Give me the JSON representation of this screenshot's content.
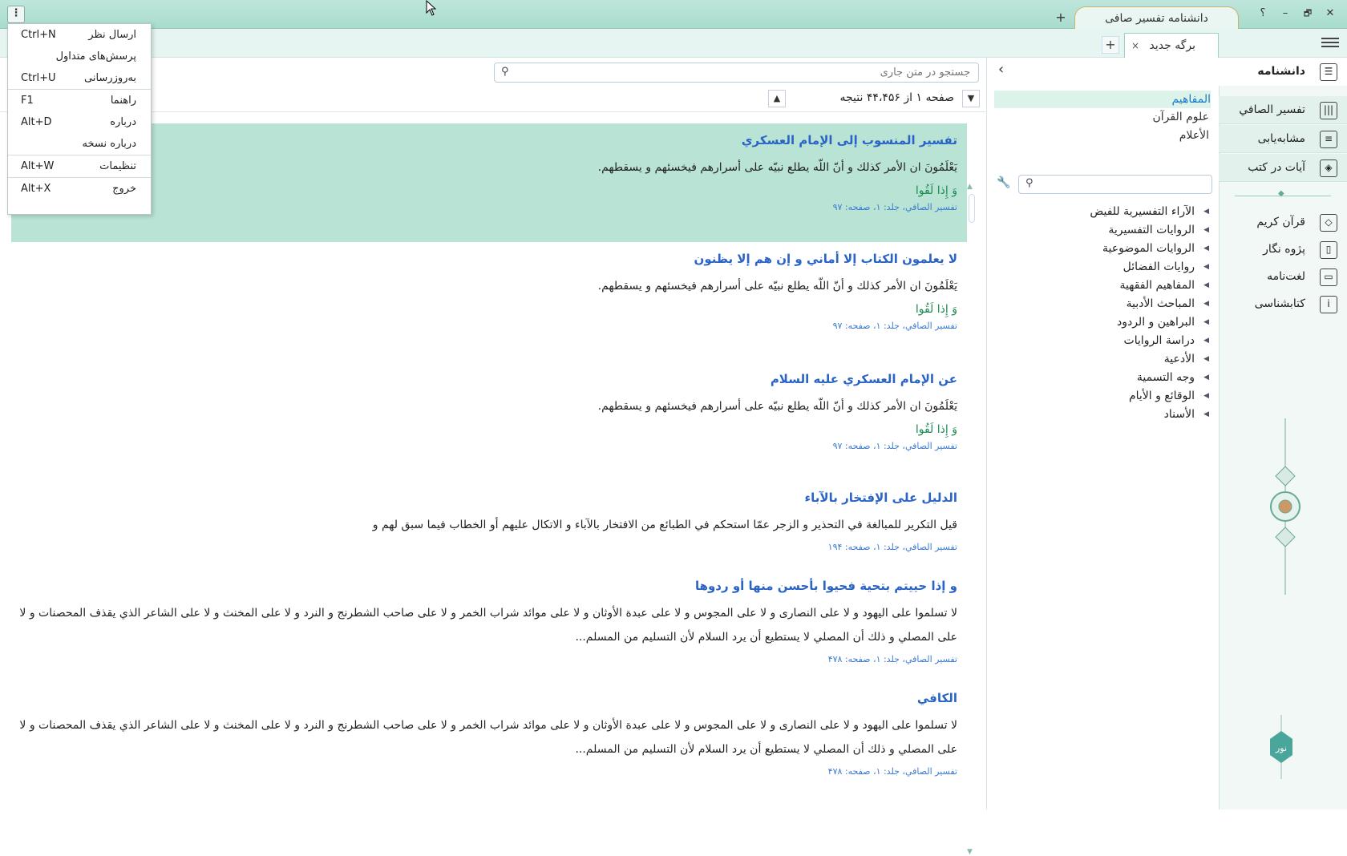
{
  "window": {
    "app_tab_title": "دانشنامه تفسیر صافی",
    "app_tab_add_label": "+",
    "title_buttons": {
      "help": "؟",
      "minimize": "–",
      "restore": "🗗",
      "close": "✕"
    },
    "menu_button": "⋮"
  },
  "tabbar": {
    "doc_tab_label": "برگه جدید",
    "doc_tab_close": "×",
    "doc_tab_add": "+"
  },
  "dropdown_menu": {
    "items": [
      {
        "label": "ارسال نظر",
        "shortcut": "Ctrl+N"
      },
      {
        "label": "پرسش‌های متداول",
        "shortcut": ""
      },
      {
        "label": "به‌روزرسانی",
        "shortcut": "Ctrl+U"
      },
      {
        "label": "راهنما",
        "shortcut": "F1"
      },
      {
        "label": "درباره",
        "shortcut": "Alt+D"
      },
      {
        "label": "درباره نسخه",
        "shortcut": ""
      },
      {
        "label": "تنظیمات",
        "shortcut": "Alt+W"
      },
      {
        "label": "خروج",
        "shortcut": "Alt+X"
      }
    ]
  },
  "rightnav": {
    "header": "دانشنامه",
    "sections": [
      "تفسیر الصافي",
      "مشابه‌یابی",
      "آیات در کتب"
    ],
    "tools": [
      "قرآن کریم",
      "پژوه نگار",
      "لغت‌نامه",
      "کتابشناسی"
    ],
    "logo_text": "نور"
  },
  "treepanel": {
    "categories": [
      "المفاهیم",
      "علوم القرآن",
      "الأعلام"
    ],
    "search_placeholder": "",
    "nodes": [
      "الآراء التفسيرية للفيض",
      "الروايات التفسيرية",
      "الروايات الموضوعية",
      "روايات الفضائل",
      "المفاهيم الفقهية",
      "المباحث الأدبية",
      "البراهين و الردود",
      "دراسة الروايات",
      "الأدعية",
      "وجه التسمية",
      "الوقائع و الأيام",
      "الأسناد"
    ]
  },
  "main": {
    "search_placeholder": "جستجو در متن جاری",
    "page_info": "صفحه ۱ از ۴۴،۴۵۶ نتیجه",
    "results": [
      {
        "title": "تفسير المنسوب إلى الإمام العسكري",
        "text": "يَعْلَمُونَ ان الأمر كذلك و أنّ اللّه يطلع نبيّه على أسرارهم فيخسئهم و يسقطهم.",
        "verse": "وَ إِذا لَقُوا",
        "cite": "تفسير الصافي، جلد: ۱، صفحه: ۹۷"
      },
      {
        "title": "لا يعلمون الكتاب إلا أماني و إن هم إلا يظنون",
        "text": "يَعْلَمُونَ ان الأمر كذلك و أنّ اللّه يطلع نبيّه على أسرارهم فيخسئهم و يسقطهم.",
        "verse": "وَ إِذا لَقُوا",
        "cite": "تفسير الصافي، جلد: ۱، صفحه: ۹۷"
      },
      {
        "title": "عن الإمام العسكري عليه السلام",
        "text": "يَعْلَمُونَ ان الأمر كذلك و أنّ اللّه يطلع نبيّه على أسرارهم فيخسئهم و يسقطهم.",
        "verse": "وَ إِذا لَقُوا",
        "cite": "تفسير الصافي، جلد: ۱، صفحه: ۹۷"
      },
      {
        "title": "الدليل على الإفتخار بالآباء",
        "text": "قيل التكرير للمبالغة في التحذير و الزجر عمّا استحكم في الطبائع من الافتخار بالآباء و الاتكال عليهم أو الخطاب فيما سبق لهم و",
        "verse": "",
        "cite": "تفسير الصافي، جلد: ۱، صفحه: ۱۹۴"
      },
      {
        "title": "و إذا حييتم بتحية فحيوا بأحسن منها أو ردوها",
        "text": "لا تسلموا على اليهود و لا على النصارى و لا على المجوس و لا على عبدة الأوثان و لا على موائد شراب الخمر و لا على صاحب الشطرنج و النرد و لا على المخنث و لا على الشاعر الذي يقذف المحصنات و لا على المصلي و ذلك أن المصلي لا يستطيع أن يرد السلام لأن التسليم من المسلم...",
        "verse": "",
        "cite": "تفسير الصافي، جلد: ۱، صفحه: ۴۷۸"
      },
      {
        "title": "الكافي",
        "text": "لا تسلموا على اليهود و لا على النصارى و لا على المجوس و لا على عبدة الأوثان و لا على موائد شراب الخمر و لا على صاحب الشطرنج و النرد و لا على المخنث و لا على الشاعر الذي يقذف المحصنات و لا على المصلي و ذلك أن المصلي لا يستطيع أن يرد السلام لأن التسليم من المسلم...",
        "verse": "",
        "cite": "تفسير الصافي، جلد: ۱، صفحه: ۴۷۸"
      }
    ]
  },
  "colors": {
    "accent_green": "#a8dccd",
    "selected_row": "#b9e3d5",
    "title_blue": "#2a64c7",
    "verse_green": "#1d8a52"
  }
}
